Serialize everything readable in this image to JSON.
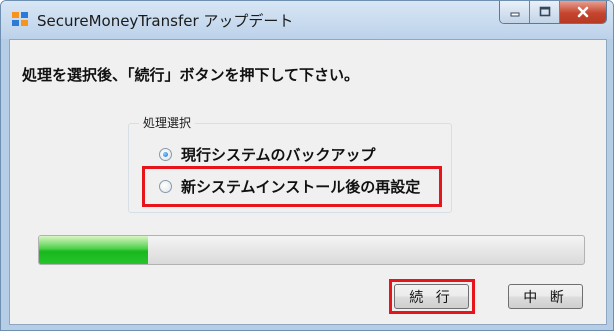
{
  "window": {
    "title": "SecureMoneyTransfer  アップデート"
  },
  "main": {
    "instruction": "処理を選択後、「続行」ボタンを押下して下さい。",
    "group_label": "処理選択",
    "options": [
      {
        "label": "現行システムのバックアップ",
        "selected": true
      },
      {
        "label": "新システムインストール後の再設定",
        "selected": false
      }
    ],
    "progress_fraction": 0.2
  },
  "buttons": {
    "continue_label": "続 行",
    "abort_label": "中 断"
  },
  "colors": {
    "highlight": "#e8141b",
    "progress": "#19b81f"
  }
}
